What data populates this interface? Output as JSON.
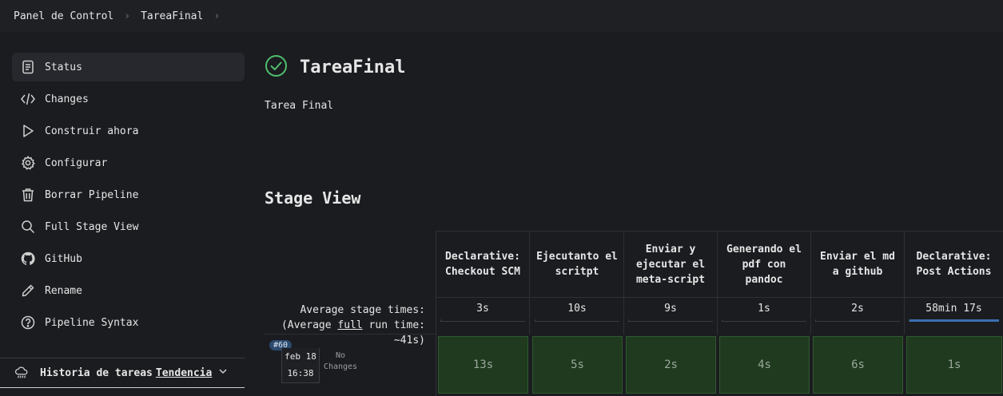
{
  "breadcrumb": {
    "items": [
      "Panel de Control",
      "TareaFinal"
    ]
  },
  "sidebar": {
    "items": [
      {
        "label": "Status",
        "icon": "document-icon"
      },
      {
        "label": "Changes",
        "icon": "code-icon"
      },
      {
        "label": "Construir ahora",
        "icon": "play-icon"
      },
      {
        "label": "Configurar",
        "icon": "gear-icon"
      },
      {
        "label": "Borrar Pipeline",
        "icon": "trash-icon"
      },
      {
        "label": "Full Stage View",
        "icon": "search-icon"
      },
      {
        "label": "GitHub",
        "icon": "github-icon"
      },
      {
        "label": "Rename",
        "icon": "pencil-icon"
      },
      {
        "label": "Pipeline Syntax",
        "icon": "help-icon"
      }
    ],
    "history": {
      "title": "Historia de tareas",
      "trend_link": "Tendencia",
      "icon": "cloud-rain-icon"
    }
  },
  "main": {
    "title": "TareaFinal",
    "status_icon": "success-check-icon",
    "status_color": "#4fbf6e",
    "description": "Tarea Final",
    "stage_view_heading": "Stage View"
  },
  "stage_view": {
    "avg_label_line1": "Average stage times:",
    "avg_label_prefix": "(Average ",
    "avg_label_link": "full",
    "avg_label_suffix": " run time:",
    "avg_label_line3": "~41s)",
    "stages": [
      {
        "name": "Declarative: Checkout SCM",
        "avg": "3s",
        "run": "13s",
        "avg_fraction": 0.0
      },
      {
        "name": "Ejecutanto el scritpt",
        "avg": "10s",
        "run": "5s",
        "avg_fraction": 0.0
      },
      {
        "name": "Enviar y ejecutar el meta-script",
        "avg": "9s",
        "run": "2s",
        "avg_fraction": 0.0
      },
      {
        "name": "Generando el pdf con pandoc",
        "avg": "1s",
        "run": "4s",
        "avg_fraction": 0.0
      },
      {
        "name": "Enviar el md a github",
        "avg": "2s",
        "run": "6s",
        "avg_fraction": 0.0
      },
      {
        "name": "Declarative: Post Actions",
        "avg": "58min 17s",
        "run": "1s",
        "avg_fraction": 1.0
      }
    ],
    "run": {
      "badge": "#60",
      "date": "feb 18",
      "time": "16:38",
      "changes": "No Changes"
    },
    "success_color": "#1f3a1f",
    "progress_color": "#3b6fb0"
  }
}
